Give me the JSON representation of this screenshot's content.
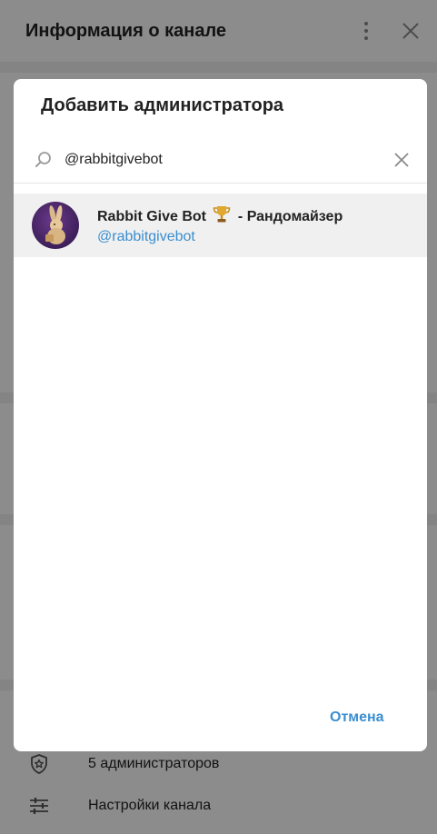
{
  "background": {
    "title": "Информация о канале",
    "rows": [
      {
        "label": "5 администраторов",
        "icon": "shield-star-icon"
      },
      {
        "label": "Настройки канала",
        "icon": "sliders-icon"
      }
    ]
  },
  "dialog": {
    "title": "Добавить администратора",
    "search": {
      "value": "@rabbitgivebot",
      "placeholder": ""
    },
    "results": [
      {
        "name_part1": "Rabbit Give Bot",
        "name_part2": "- Рандомайзер",
        "emoji": "trophy-icon",
        "username": "@rabbitgivebot",
        "avatar": "rabbit-avatar"
      }
    ],
    "cancel_label": "Отмена"
  },
  "colors": {
    "accent": "#3a8ecf",
    "overlay": "rgba(0,0,0,0.45)",
    "avatar_bg": "#3e1f5a"
  }
}
